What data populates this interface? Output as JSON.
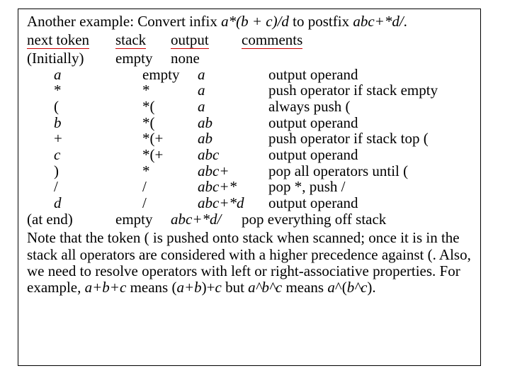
{
  "title": {
    "pre": "Another example: Convert infix ",
    "infix": "a*(b + c)/d",
    "mid": " to postfix ",
    "postfix": "abc+*d/",
    "post": "."
  },
  "headers": {
    "c1": "next token",
    "c2": "stack",
    "c3": "output",
    "c4": "comments"
  },
  "rows": [
    {
      "tok": "(Initially)",
      "ind": false,
      "it": false,
      "stack": "empty",
      "out": "none",
      "outit": false,
      "comment": ""
    },
    {
      "tok": "a",
      "ind": true,
      "it": true,
      "stack": "empty",
      "out": "a",
      "outit": true,
      "comment": "output operand"
    },
    {
      "tok": "*",
      "ind": true,
      "it": false,
      "stack": "*",
      "out": "a",
      "outit": true,
      "comment": "push operator if stack empty"
    },
    {
      "tok": "(",
      "ind": true,
      "it": false,
      "stack": "*(",
      "out": "a",
      "outit": true,
      "comment": "always push ("
    },
    {
      "tok": "b",
      "ind": true,
      "it": true,
      "stack": "*(",
      "out": "ab",
      "outit": true,
      "comment": "output operand"
    },
    {
      "tok": "+",
      "ind": true,
      "it": false,
      "stack": "*(+",
      "out": "ab",
      "outit": true,
      "comment": "push operator if stack top ("
    },
    {
      "tok": "c",
      "ind": true,
      "it": true,
      "stack": "*(+",
      "out": "abc",
      "outit": true,
      "comment": "output operand"
    },
    {
      "tok": ")",
      "ind": true,
      "it": false,
      "stack": "*",
      "out": "abc+",
      "outit": true,
      "comment": "pop all operators until ("
    },
    {
      "tok": "/",
      "ind": true,
      "it": false,
      "stack": "/",
      "out": "abc+*",
      "outit": true,
      "comment": "pop *, push /"
    },
    {
      "tok": "d",
      "ind": true,
      "it": true,
      "stack": "/",
      "out": "abc+*d",
      "outit": true,
      "comment": "output operand"
    },
    {
      "tok": "(at end)",
      "ind": false,
      "it": false,
      "stack": "empty",
      "out": "abc+*d/",
      "outit": true,
      "comment": " pop everything off stack"
    }
  ],
  "note": {
    "p1a": "Note that the token ( is pushed onto stack when scanned; once it is in the stack all operators are considered with a higher precedence against (.  Also, we need to resolve operators with left or right-associative properties.  For example, ",
    "e1": "a+b+c",
    "p1b": " means (",
    "e2": "a+b",
    "p1c": ")+",
    "e3": "c",
    "p1d": " but ",
    "e4": "a^b^c",
    "p1e": " means ",
    "e5": "a",
    "p1f": "^(",
    "e6": "b^c",
    "p1g": ")."
  }
}
